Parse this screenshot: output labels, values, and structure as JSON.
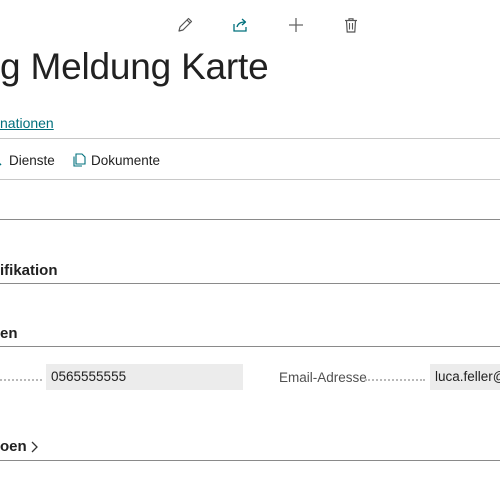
{
  "toolbar": {
    "icons": [
      "pencil-edit-icon",
      "share-icon",
      "plus-icon",
      "trash-icon"
    ]
  },
  "page": {
    "title": "g Meldung Karte",
    "info_link": "nationen"
  },
  "actions": {
    "dienste_label": "Dienste",
    "dokumente_label": "Dokumente"
  },
  "sections": {
    "identification_title": "ifikation",
    "contact_title": "en",
    "more_title": "oen"
  },
  "fields": {
    "phone_value": "0565555555",
    "email_label": "Email-Adresse",
    "email_value": "luca.feller@"
  },
  "colors": {
    "accent": "#00707c",
    "field_bg": "#ececec",
    "text": "#212121"
  }
}
